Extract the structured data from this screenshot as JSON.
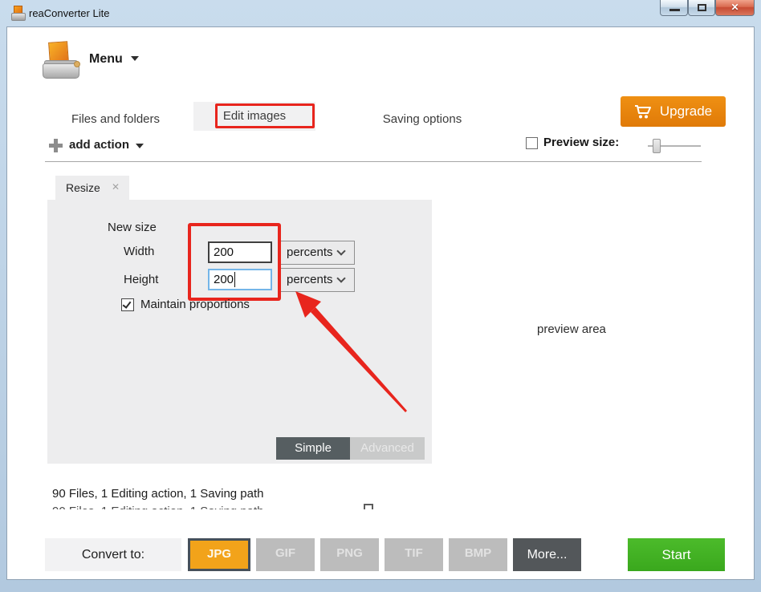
{
  "window": {
    "title": "reaConverter Lite"
  },
  "icons": {
    "window_close_glyph": "✕",
    "tab_close_glyph": "✕"
  },
  "menu": {
    "label": "Menu"
  },
  "nav": {
    "tabs": [
      {
        "label": "Files and folders",
        "active": false
      },
      {
        "label": "Edit images",
        "active": true,
        "annotated": true
      },
      {
        "label": "Saving options",
        "active": false
      }
    ],
    "upgrade_label": "Upgrade"
  },
  "toolbar": {
    "add_action_label": "add action",
    "preview_size_label": "Preview size:",
    "preview_size_checked": false
  },
  "editor": {
    "action_tab_label": "Resize",
    "new_size_label": "New size",
    "width_label": "Width",
    "width_value": "200",
    "width_unit": "percents",
    "height_label": "Height",
    "height_value": "200",
    "height_unit": "percents",
    "height_focused": true,
    "maintain_label": "Maintain proportions",
    "maintain_checked": true,
    "simple_label": "Simple",
    "advanced_label": "Advanced",
    "active_mode": "Simple"
  },
  "preview": {
    "label": "preview area"
  },
  "status": {
    "summary": "90 Files, 1 Editing action, 1 Saving path"
  },
  "footer": {
    "convert_label": "Convert to:",
    "formats": [
      {
        "label": "JPG",
        "selected": true
      },
      {
        "label": "GIF",
        "selected": false
      },
      {
        "label": "PNG",
        "selected": false
      },
      {
        "label": "TIF",
        "selected": false
      },
      {
        "label": "BMP",
        "selected": false
      }
    ],
    "more_label": "More...",
    "start_label": "Start"
  },
  "colors": {
    "accent_orange": "#e8830e",
    "format_selected_orange": "#f2a31a",
    "start_green": "#3fb022",
    "annotation_red": "#e8251d",
    "titlebar_blue": "#bdd2e6"
  }
}
